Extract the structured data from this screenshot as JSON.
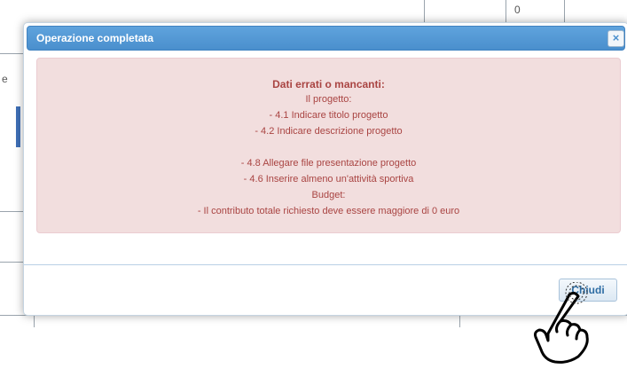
{
  "dialog": {
    "title": "Operazione completata",
    "close_glyph": "×",
    "close_icon": "close-icon"
  },
  "alert": {
    "title": "Dati errati o mancanti:",
    "lines": [
      "Il progetto:",
      "- 4.1 Indicare titolo progetto",
      "- 4.2 Indicare descrizione progetto",
      "",
      "- 4.8 Allegare file presentazione progetto",
      "- 4.6 Inserire almeno un'attività sportiva",
      "Budget:",
      "- Il contributo totale richiesto deve essere maggiore di 0 euro"
    ]
  },
  "footer": {
    "chiudi_label": "Chiudi"
  },
  "background": {
    "glyph_top": "0",
    "glyph_left": "e"
  },
  "colors": {
    "titlebar": "#4a8fcd",
    "alert_bg": "#f2dede",
    "alert_text": "#a94442",
    "button_text": "#2e6da4"
  },
  "cursor_icon": "hand-pointer-icon"
}
